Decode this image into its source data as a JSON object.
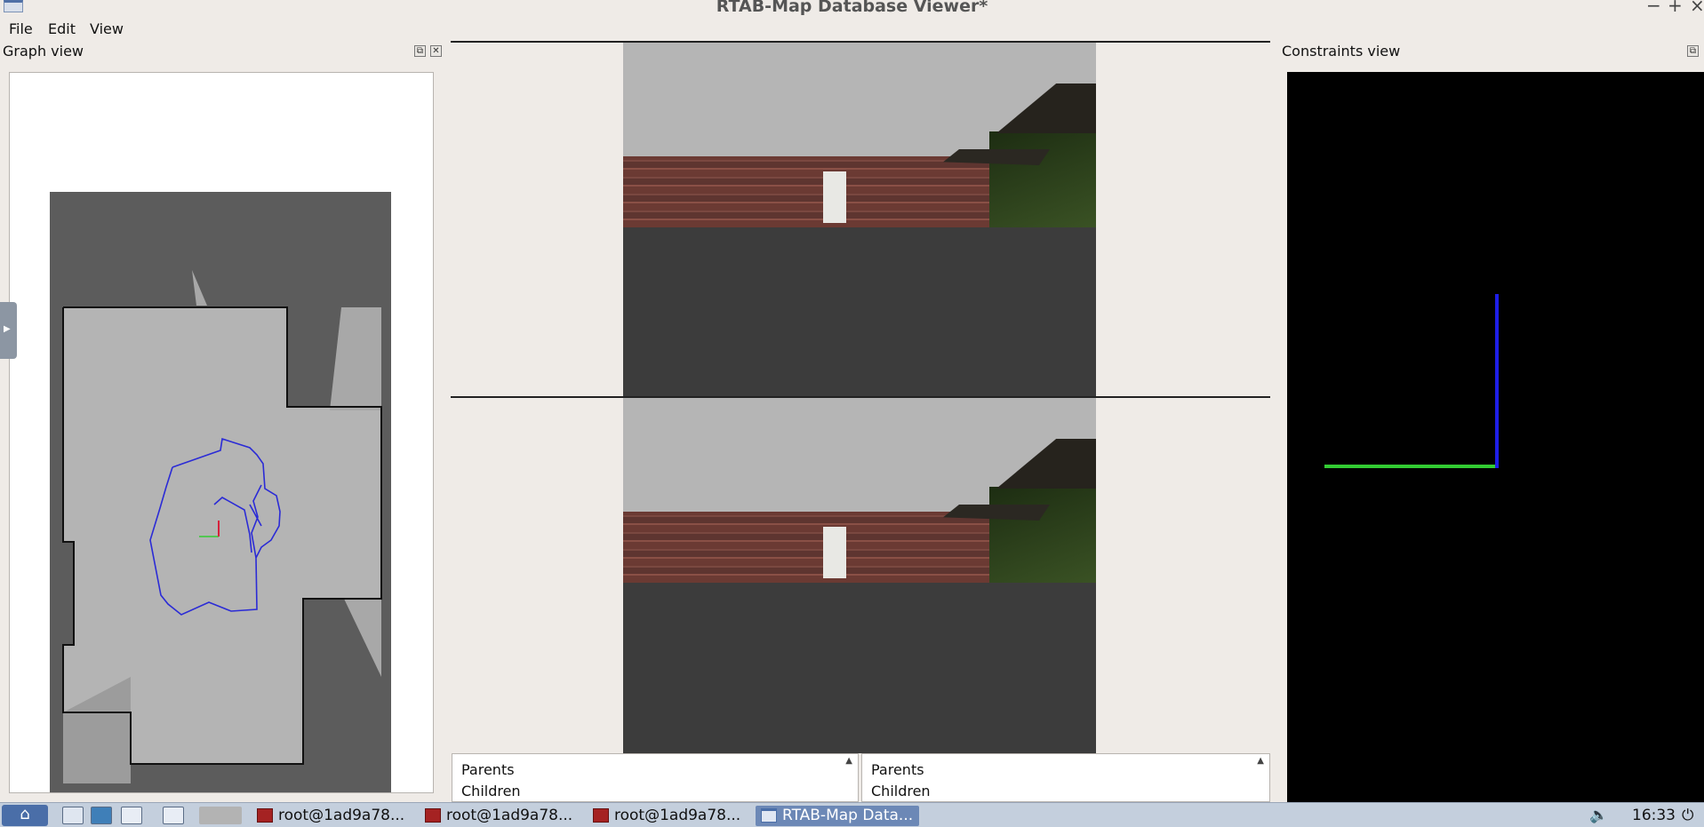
{
  "window": {
    "title": "RTAB-Map Database Viewer*",
    "minimize": "−",
    "maximize": "+",
    "close": "×"
  },
  "menu": [
    "File",
    "Edit",
    "View"
  ],
  "graph_view": {
    "title": "Graph view",
    "float_btn": "⧉",
    "close_btn": "✕"
  },
  "constraints_view": {
    "title": "Constraints view",
    "float_btn": "⧉"
  },
  "info_lists": [
    {
      "parents": "Parents",
      "children": "Children"
    },
    {
      "parents": "Parents",
      "children": "Children"
    }
  ],
  "taskbar": {
    "tasks": [
      {
        "label": "root@1ad9a78...",
        "active": false
      },
      {
        "label": "root@1ad9a78...",
        "active": false
      },
      {
        "label": "root@1ad9a78...",
        "active": false
      },
      {
        "label": "RTAB-Map Data...",
        "active": true
      }
    ],
    "time": "16:33"
  },
  "colors": {
    "trajectory": "#2b2bd6",
    "axis_x": "#33cc33",
    "axis_y": "#1e1ee6",
    "map_free": "#b4b4b4",
    "map_unknown": "#5c5c5c"
  }
}
